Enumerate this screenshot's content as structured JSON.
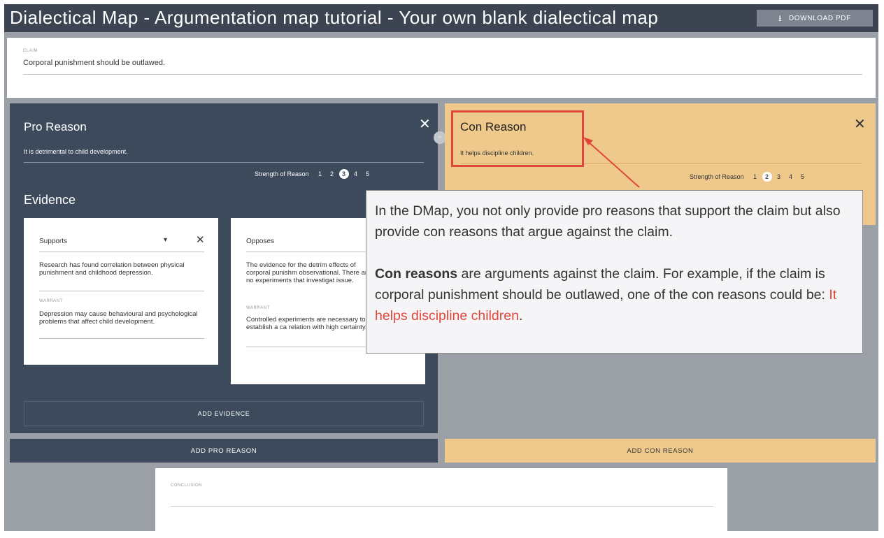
{
  "app": {
    "title": "Dialectical Map - Argumentation map tutorial - Your own blank dialectical map",
    "download_label": "DOWNLOAD PDF",
    "download_icon": "download-icon"
  },
  "claim": {
    "label": "CLAIM",
    "text": "Corporal punishment should be outlawed."
  },
  "pro": {
    "title": "Pro Reason",
    "close": "✕",
    "reason": "It is detrimental to child development.",
    "strength_label": "Strength of Reason",
    "strength_options": [
      "1",
      "2",
      "3",
      "4",
      "5"
    ],
    "strength_selected": "3",
    "evidence_title": "Evidence",
    "evidence": [
      {
        "type": "Supports",
        "chevron": "▾",
        "close": "✕",
        "text": "Research has found correlation between physical punishment and childhood depression.",
        "warrant_label": "WARRANT",
        "warrant": "Depression may cause behavioural and psychological problems that affect child development."
      },
      {
        "type": "Opposes",
        "text": "The evidence for the detrim effects of corporal punishm observational. There are no experiments that investigat issue.",
        "warrant_label": "WARRANT",
        "warrant": "Controlled experiments are necessary to establish a ca relation with high certainty."
      }
    ],
    "add_evidence": "ADD EVIDENCE",
    "add_reason": "ADD PRO REASON"
  },
  "con": {
    "title": "Con Reason",
    "close": "✕",
    "reason": "It helps discipline children.",
    "strength_label": "Strength of Reason",
    "strength_options": [
      "1",
      "2",
      "3",
      "4",
      "5"
    ],
    "strength_selected": "2",
    "add_reason": "ADD CON REASON"
  },
  "toggle": {
    "label": "›‹"
  },
  "tooltip": {
    "p1": "In the DMap, you not only provide pro reasons that support the claim but also provide con reasons that argue against the claim.",
    "p2_bold": "Con reasons",
    "p2_text": " are arguments against the claim. For example, if the claim is corporal punishment should be outlawed, one of the con reasons could be: ",
    "p2_highlight": "It helps discipline children",
    "p2_end": ".",
    "highlight_color": "#e0473b"
  },
  "conclusion": {
    "label": "CONCLUSION"
  },
  "colors": {
    "pro_panel": "#3c4a5c",
    "con_panel": "#eec98b",
    "topbar": "#3c4452",
    "annotation": "#e0473b"
  }
}
